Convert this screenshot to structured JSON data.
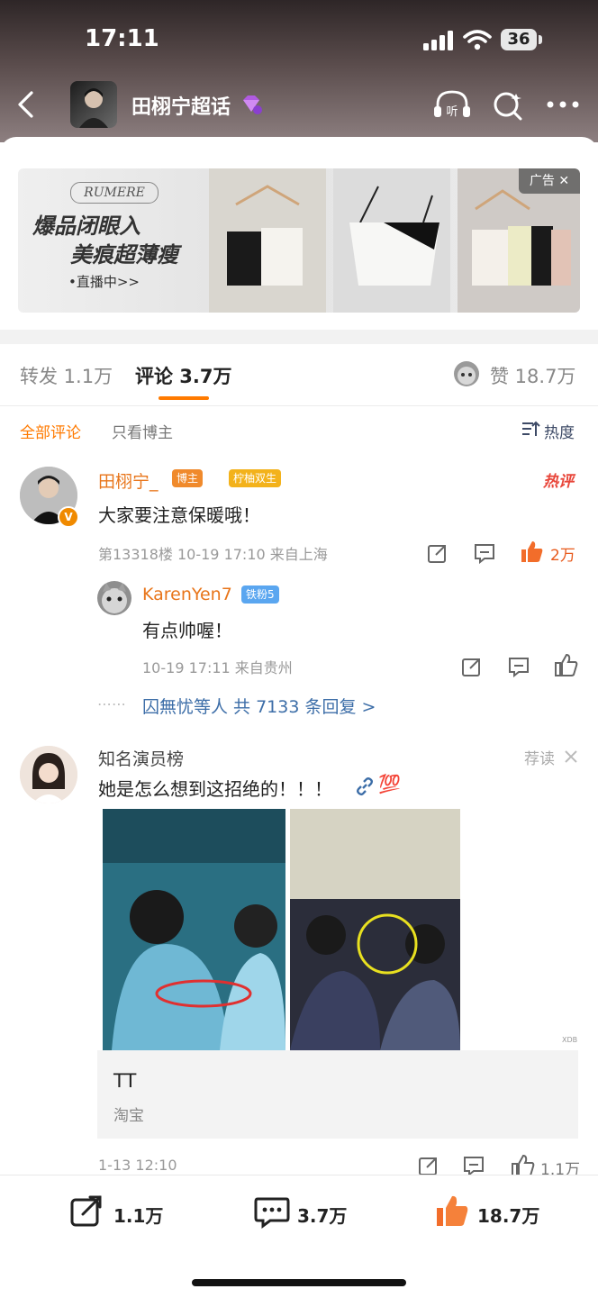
{
  "status_bar": {
    "time": "17:11",
    "battery": "36"
  },
  "header": {
    "title": "田栩宁超话",
    "listen_label": "听"
  },
  "ad": {
    "brand": "RUMERE",
    "headline_1": "爆品闭眼入",
    "headline_2": "美痕超薄瘦",
    "live_text": "•直播中>>",
    "ad_tag": "广告 ✕"
  },
  "tabs": {
    "repost": "转发 1.1万",
    "comments": "评论 3.7万",
    "likes": "赞 18.7万"
  },
  "filters": {
    "all": "全部评论",
    "author_only": "只看博主",
    "sort": "热度"
  },
  "comments": [
    {
      "username": "田栩宁_",
      "badge_author": "博主",
      "badge_fan": "柠柚双生",
      "hot_label": "热评",
      "text": "大家要注意保暖哦！",
      "meta": "第13318楼 10-19 17:10 来自上海",
      "likes": "2万",
      "reply": {
        "username": "KarenYen7",
        "badge": "铁粉5",
        "text": "有点帅喔！",
        "meta": "10-19 17:11 来自贵州"
      },
      "more_replies": "囚無忧等人  共 7133 条回复 >"
    },
    {
      "username": "知名演员榜",
      "recommend": "荐读",
      "text": "她是怎么想到这招绝的！！！",
      "emoji_100": "💯",
      "watermark": "XDB",
      "card_title": "TT",
      "card_sub": "淘宝",
      "meta": "1-13 12:10",
      "likes": "1.1万"
    }
  ],
  "bottom_bar": {
    "repost": "1.1万",
    "comment": "3.7万",
    "like": "18.7万"
  },
  "colors": {
    "accent": "#ff7a00",
    "username": "#e8751a",
    "link_blue": "#3d6ea8"
  }
}
